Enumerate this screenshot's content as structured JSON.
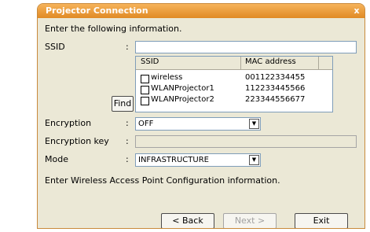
{
  "window": {
    "title": "Projector Connection",
    "close_glyph": "x"
  },
  "instruction": "Enter the following information.",
  "ssid": {
    "label": "SSID",
    "colon": ":",
    "value": ""
  },
  "find_button": "Find",
  "networks": {
    "columns": [
      "SSID",
      "MAC address"
    ],
    "rows": [
      {
        "ssid": "wireless",
        "mac": "001122334455",
        "checked": false
      },
      {
        "ssid": "WLANProjector1",
        "mac": "112233445566",
        "checked": false
      },
      {
        "ssid": "WLANProjector2",
        "mac": "223344556677",
        "checked": false
      }
    ]
  },
  "encryption": {
    "label": "Encryption",
    "colon": ":",
    "value": "OFF"
  },
  "encryption_key": {
    "label": "Encryption key",
    "colon": ":",
    "value": ""
  },
  "mode": {
    "label": "Mode",
    "colon": ":",
    "value": "INFRASTRUCTURE"
  },
  "footer_text": "Enter Wireless Access Point Configuration information.",
  "buttons": {
    "back": "< Back",
    "next": "Next >",
    "exit": "Exit"
  }
}
